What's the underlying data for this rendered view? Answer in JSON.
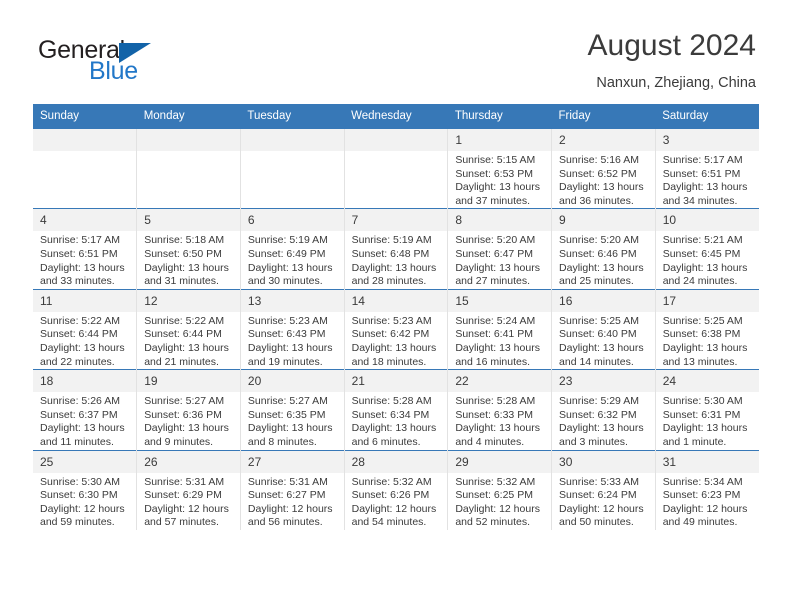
{
  "logo": {
    "word_one": "General",
    "word_two": "Blue",
    "triangle_color": "#1263a8",
    "blue_color": "#2277c8"
  },
  "header": {
    "title": "August 2024",
    "subtitle": "Nanxun, Zhejiang, China"
  },
  "theme": {
    "header_blue": "#3778b7",
    "daynum_gray": "#f2f2f2",
    "text": "#3b3b3b"
  },
  "weekday_headers": [
    "Sunday",
    "Monday",
    "Tuesday",
    "Wednesday",
    "Thursday",
    "Friday",
    "Saturday"
  ],
  "weeks": [
    [
      {
        "day": "",
        "sunrise": "",
        "sunset": "",
        "daylight": "",
        "empty": true
      },
      {
        "day": "",
        "sunrise": "",
        "sunset": "",
        "daylight": "",
        "empty": true
      },
      {
        "day": "",
        "sunrise": "",
        "sunset": "",
        "daylight": "",
        "empty": true
      },
      {
        "day": "",
        "sunrise": "",
        "sunset": "",
        "daylight": "",
        "empty": true
      },
      {
        "day": "1",
        "sunrise": "Sunrise: 5:15 AM",
        "sunset": "Sunset: 6:53 PM",
        "daylight": "Daylight: 13 hours and 37 minutes."
      },
      {
        "day": "2",
        "sunrise": "Sunrise: 5:16 AM",
        "sunset": "Sunset: 6:52 PM",
        "daylight": "Daylight: 13 hours and 36 minutes."
      },
      {
        "day": "3",
        "sunrise": "Sunrise: 5:17 AM",
        "sunset": "Sunset: 6:51 PM",
        "daylight": "Daylight: 13 hours and 34 minutes."
      }
    ],
    [
      {
        "day": "4",
        "sunrise": "Sunrise: 5:17 AM",
        "sunset": "Sunset: 6:51 PM",
        "daylight": "Daylight: 13 hours and 33 minutes."
      },
      {
        "day": "5",
        "sunrise": "Sunrise: 5:18 AM",
        "sunset": "Sunset: 6:50 PM",
        "daylight": "Daylight: 13 hours and 31 minutes."
      },
      {
        "day": "6",
        "sunrise": "Sunrise: 5:19 AM",
        "sunset": "Sunset: 6:49 PM",
        "daylight": "Daylight: 13 hours and 30 minutes."
      },
      {
        "day": "7",
        "sunrise": "Sunrise: 5:19 AM",
        "sunset": "Sunset: 6:48 PM",
        "daylight": "Daylight: 13 hours and 28 minutes."
      },
      {
        "day": "8",
        "sunrise": "Sunrise: 5:20 AM",
        "sunset": "Sunset: 6:47 PM",
        "daylight": "Daylight: 13 hours and 27 minutes."
      },
      {
        "day": "9",
        "sunrise": "Sunrise: 5:20 AM",
        "sunset": "Sunset: 6:46 PM",
        "daylight": "Daylight: 13 hours and 25 minutes."
      },
      {
        "day": "10",
        "sunrise": "Sunrise: 5:21 AM",
        "sunset": "Sunset: 6:45 PM",
        "daylight": "Daylight: 13 hours and 24 minutes."
      }
    ],
    [
      {
        "day": "11",
        "sunrise": "Sunrise: 5:22 AM",
        "sunset": "Sunset: 6:44 PM",
        "daylight": "Daylight: 13 hours and 22 minutes."
      },
      {
        "day": "12",
        "sunrise": "Sunrise: 5:22 AM",
        "sunset": "Sunset: 6:44 PM",
        "daylight": "Daylight: 13 hours and 21 minutes."
      },
      {
        "day": "13",
        "sunrise": "Sunrise: 5:23 AM",
        "sunset": "Sunset: 6:43 PM",
        "daylight": "Daylight: 13 hours and 19 minutes."
      },
      {
        "day": "14",
        "sunrise": "Sunrise: 5:23 AM",
        "sunset": "Sunset: 6:42 PM",
        "daylight": "Daylight: 13 hours and 18 minutes."
      },
      {
        "day": "15",
        "sunrise": "Sunrise: 5:24 AM",
        "sunset": "Sunset: 6:41 PM",
        "daylight": "Daylight: 13 hours and 16 minutes."
      },
      {
        "day": "16",
        "sunrise": "Sunrise: 5:25 AM",
        "sunset": "Sunset: 6:40 PM",
        "daylight": "Daylight: 13 hours and 14 minutes."
      },
      {
        "day": "17",
        "sunrise": "Sunrise: 5:25 AM",
        "sunset": "Sunset: 6:38 PM",
        "daylight": "Daylight: 13 hours and 13 minutes."
      }
    ],
    [
      {
        "day": "18",
        "sunrise": "Sunrise: 5:26 AM",
        "sunset": "Sunset: 6:37 PM",
        "daylight": "Daylight: 13 hours and 11 minutes."
      },
      {
        "day": "19",
        "sunrise": "Sunrise: 5:27 AM",
        "sunset": "Sunset: 6:36 PM",
        "daylight": "Daylight: 13 hours and 9 minutes."
      },
      {
        "day": "20",
        "sunrise": "Sunrise: 5:27 AM",
        "sunset": "Sunset: 6:35 PM",
        "daylight": "Daylight: 13 hours and 8 minutes."
      },
      {
        "day": "21",
        "sunrise": "Sunrise: 5:28 AM",
        "sunset": "Sunset: 6:34 PM",
        "daylight": "Daylight: 13 hours and 6 minutes."
      },
      {
        "day": "22",
        "sunrise": "Sunrise: 5:28 AM",
        "sunset": "Sunset: 6:33 PM",
        "daylight": "Daylight: 13 hours and 4 minutes."
      },
      {
        "day": "23",
        "sunrise": "Sunrise: 5:29 AM",
        "sunset": "Sunset: 6:32 PM",
        "daylight": "Daylight: 13 hours and 3 minutes."
      },
      {
        "day": "24",
        "sunrise": "Sunrise: 5:30 AM",
        "sunset": "Sunset: 6:31 PM",
        "daylight": "Daylight: 13 hours and 1 minute."
      }
    ],
    [
      {
        "day": "25",
        "sunrise": "Sunrise: 5:30 AM",
        "sunset": "Sunset: 6:30 PM",
        "daylight": "Daylight: 12 hours and 59 minutes."
      },
      {
        "day": "26",
        "sunrise": "Sunrise: 5:31 AM",
        "sunset": "Sunset: 6:29 PM",
        "daylight": "Daylight: 12 hours and 57 minutes."
      },
      {
        "day": "27",
        "sunrise": "Sunrise: 5:31 AM",
        "sunset": "Sunset: 6:27 PM",
        "daylight": "Daylight: 12 hours and 56 minutes."
      },
      {
        "day": "28",
        "sunrise": "Sunrise: 5:32 AM",
        "sunset": "Sunset: 6:26 PM",
        "daylight": "Daylight: 12 hours and 54 minutes."
      },
      {
        "day": "29",
        "sunrise": "Sunrise: 5:32 AM",
        "sunset": "Sunset: 6:25 PM",
        "daylight": "Daylight: 12 hours and 52 minutes."
      },
      {
        "day": "30",
        "sunrise": "Sunrise: 5:33 AM",
        "sunset": "Sunset: 6:24 PM",
        "daylight": "Daylight: 12 hours and 50 minutes."
      },
      {
        "day": "31",
        "sunrise": "Sunrise: 5:34 AM",
        "sunset": "Sunset: 6:23 PM",
        "daylight": "Daylight: 12 hours and 49 minutes."
      }
    ]
  ]
}
